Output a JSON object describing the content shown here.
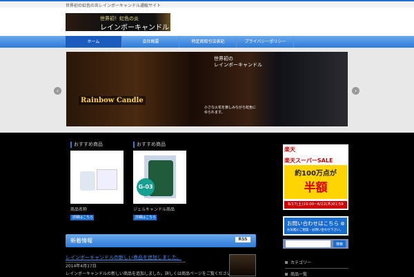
{
  "topbar": {
    "tagline": "世界初の虹色の炎レインボーキャンドル通販サイト"
  },
  "logo": {
    "line1": "世界初！虹色の炎",
    "line2": "レインボーキャンドル"
  },
  "nav": {
    "items": [
      {
        "label": "ホーム"
      },
      {
        "label": "会社概要"
      },
      {
        "label": "特定商取引法表記"
      },
      {
        "label": "プライバシーポリシー"
      }
    ]
  },
  "slider": {
    "title1": "世界初の",
    "title2": "レインボーキャンドル",
    "brand": "Rainbow Candle",
    "caption1": "小さな火花を楽しみながら虹色に",
    "caption2": "ゆられます。",
    "prev": "‹",
    "next": "›"
  },
  "products": [
    {
      "section": "おすすめ商品",
      "name": "商品名称",
      "button": "詳細はこちら"
    },
    {
      "section": "おすすめ商品",
      "name": "ジェルキャンドル商品",
      "button": "詳細はこちら"
    }
  ],
  "news": {
    "title": "新着情報",
    "rss": "RSS",
    "post_title": "レインボーキャンドルの新しい商品を追加しました。",
    "post_date": "2014年4月17日",
    "post_body": "レインボーキャンドルの新しい商品を追加しました。詳しくは商品ページをご覧ください。"
  },
  "banner": {
    "brand": "楽天",
    "sale": "楽天スーパーSALE",
    "line1": "約100万点が",
    "line2": "半額",
    "dates": "6/17(土)19:00~6/22(木)01:59"
  },
  "contact": {
    "title": "お問い合わせはこちら ⊗",
    "sub": "お気軽にご相談・お問い合わせ下さい。"
  },
  "search": {
    "placeholder": "",
    "button": "検索"
  },
  "sidebar": {
    "items": [
      {
        "label": "カテゴリー"
      },
      {
        "label": "商品一覧"
      }
    ]
  }
}
